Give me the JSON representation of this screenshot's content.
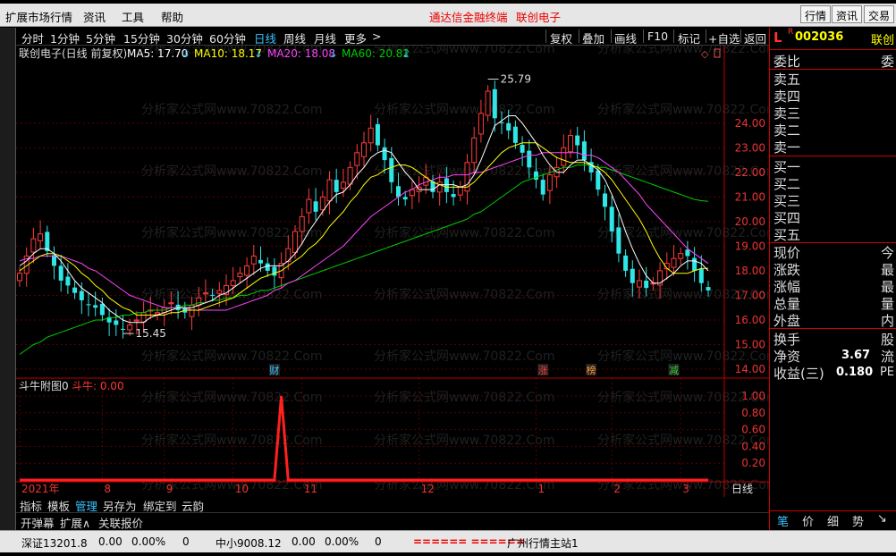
{
  "menu": {
    "items": [
      "扩展市场行情",
      "资讯",
      "工具",
      "帮助"
    ],
    "brand": "通达信金融终端",
    "stock_title": "联创电子",
    "right_buttons": [
      "行情",
      "资讯",
      "交易"
    ]
  },
  "toolbar": {
    "timeframes": [
      "分时",
      "1分钟",
      "5分钟",
      "15分钟",
      "30分钟",
      "60分钟",
      "日线",
      "周线",
      "月线",
      "更多"
    ],
    "active": "日线",
    "more_arrow": ">",
    "actions": [
      "复权",
      "叠加",
      "画线",
      "F10",
      "标记",
      "+自选",
      "返回"
    ]
  },
  "header": {
    "name": "联创电子(日线 前复权)",
    "ma5": "MA5: 17.70",
    "ma10": "MA10: 18.17",
    "ma20": "MA20: 18.08",
    "ma60": "MA60: 20.82",
    "down": "↓"
  },
  "quote": {
    "marker": "L",
    "r": "R",
    "code": "002036",
    "name": "联创",
    "wb": "委比",
    "wc": "委",
    "sell": [
      "卖五",
      "卖四",
      "卖三",
      "卖二",
      "卖一"
    ],
    "buy": [
      "买一",
      "买二",
      "买三",
      "买四",
      "买五"
    ],
    "fields": [
      "现价",
      "涨跌",
      "涨幅",
      "总量",
      "外盘"
    ],
    "fields_r": [
      "今",
      "最",
      "最",
      "量",
      "内"
    ],
    "turnover": "换手",
    "turnover_r": "股",
    "nav": "净资",
    "nav_v": "3.67",
    "nav_r": "流",
    "eps": "收益(三)",
    "eps_v": "0.180",
    "eps_r": "PE",
    "bottom_tabs": [
      "笔",
      "价",
      "细",
      "势"
    ]
  },
  "chart_data": {
    "type": "candlestick",
    "title": "联创电子(日线 前复权)",
    "ylim": [
      14.0,
      26.5
    ],
    "y_ticks": [
      "24.00",
      "23.00",
      "22.00",
      "21.00",
      "20.00",
      "19.00",
      "18.00",
      "17.00",
      "16.00",
      "15.00",
      "14.00"
    ],
    "x_ticks": [
      "2021年",
      "8",
      "9",
      "10",
      "11",
      "12",
      "1",
      "2",
      "3"
    ],
    "annotations": {
      "high": "25.79",
      "low": "15.45"
    },
    "events": [
      "财",
      "涨",
      "榜",
      "减"
    ],
    "ma_colors": {
      "ma5": "#ffffff",
      "ma10": "#ffff00",
      "ma20": "#ff44ff",
      "ma60": "#00cc00"
    },
    "close": [
      17.9,
      18.6,
      19.3,
      19.5,
      18.8,
      18.2,
      17.6,
      17.4,
      17.1,
      16.8,
      16.6,
      16.5,
      16.2,
      15.9,
      15.8,
      15.6,
      15.8,
      16.0,
      16.3,
      16.4,
      16.3,
      16.5,
      16.7,
      16.4,
      16.3,
      16.6,
      16.9,
      17.1,
      17.0,
      17.2,
      17.4,
      17.6,
      17.9,
      18.2,
      18.6,
      18.3,
      18.0,
      17.8,
      18.3,
      18.9,
      19.6,
      20.2,
      20.9,
      20.4,
      21.0,
      21.7,
      21.2,
      21.6,
      22.2,
      22.8,
      23.2,
      23.8,
      23.1,
      22.5,
      21.6,
      21.0,
      20.9,
      21.3,
      21.4,
      21.8,
      21.2,
      21.6,
      21.2,
      21.0,
      21.4,
      22.4,
      23.4,
      24.4,
      25.3,
      24.2,
      24.0,
      23.7,
      23.2,
      22.8,
      22.2,
      21.7,
      21.1,
      21.9,
      22.2,
      23.0,
      23.5,
      23.1,
      22.5,
      22.0,
      21.3,
      20.6,
      19.6,
      18.7,
      18.0,
      17.5,
      17.6,
      17.3,
      17.5,
      18.0,
      18.3,
      18.5,
      18.7,
      18.6,
      18.0,
      17.5,
      17.2
    ],
    "ma5": [
      18.2,
      18.4,
      18.7,
      18.9,
      18.9,
      18.7,
      18.4,
      18.0,
      17.6,
      17.3,
      17.1,
      16.9,
      16.7,
      16.4,
      16.2,
      16.0,
      15.9,
      15.9,
      15.9,
      16.1,
      16.2,
      16.3,
      16.4,
      16.5,
      16.5,
      16.5,
      16.6,
      16.7,
      16.8,
      17.0,
      17.1,
      17.3,
      17.5,
      17.7,
      17.9,
      18.1,
      18.2,
      18.2,
      18.2,
      18.4,
      18.7,
      19.1,
      19.6,
      20.0,
      20.4,
      20.8,
      21.1,
      21.2,
      21.5,
      21.9,
      22.2,
      22.6,
      22.8,
      22.9,
      22.8,
      22.4,
      22.0,
      21.7,
      21.3,
      21.3,
      21.3,
      21.5,
      21.5,
      21.5,
      21.4,
      21.5,
      21.9,
      22.5,
      23.2,
      23.9,
      24.1,
      24.3,
      24.3,
      24.0,
      23.6,
      23.2,
      22.7,
      22.3,
      22.0,
      22.0,
      22.3,
      22.5,
      22.5,
      22.3,
      22.1,
      21.7,
      21.1,
      20.4,
      19.6,
      18.9,
      18.3,
      17.8,
      17.5,
      17.5,
      17.7,
      17.9,
      18.2,
      18.4,
      18.4,
      18.3,
      18.0
    ],
    "ma10": [
      18.0,
      18.2,
      18.4,
      18.6,
      18.7,
      18.7,
      18.6,
      18.4,
      18.2,
      17.9,
      17.7,
      17.4,
      17.2,
      16.9,
      16.7,
      16.5,
      16.4,
      16.2,
      16.2,
      16.2,
      16.2,
      16.2,
      16.3,
      16.3,
      16.4,
      16.4,
      16.4,
      16.5,
      16.6,
      16.7,
      16.8,
      16.9,
      17.1,
      17.3,
      17.5,
      17.7,
      17.8,
      17.9,
      18.0,
      18.2,
      18.4,
      18.6,
      18.9,
      19.1,
      19.4,
      19.8,
      20.1,
      20.4,
      20.8,
      21.1,
      21.5,
      21.8,
      21.9,
      22.1,
      22.2,
      22.3,
      22.3,
      22.2,
      22.0,
      21.8,
      21.6,
      21.5,
      21.4,
      21.4,
      21.4,
      21.4,
      21.6,
      21.9,
      22.2,
      22.5,
      22.8,
      23.0,
      23.1,
      23.2,
      23.2,
      23.2,
      23.0,
      22.8,
      22.6,
      22.5,
      22.4,
      22.4,
      22.4,
      22.3,
      22.2,
      22.0,
      21.7,
      21.3,
      20.9,
      20.5,
      20.1,
      19.6,
      19.0,
      18.5,
      18.1,
      17.9,
      17.9,
      17.9,
      18.0,
      18.1,
      18.1
    ],
    "ma20": [
      18.4,
      18.5,
      18.5,
      18.6,
      18.6,
      18.6,
      18.6,
      18.5,
      18.4,
      18.3,
      18.1,
      18.0,
      17.8,
      17.6,
      17.4,
      17.2,
      17.0,
      16.9,
      16.8,
      16.7,
      16.6,
      16.5,
      16.5,
      16.5,
      16.5,
      16.4,
      16.4,
      16.4,
      16.4,
      16.4,
      16.4,
      16.5,
      16.6,
      16.7,
      16.8,
      16.9,
      17.0,
      17.2,
      17.3,
      17.5,
      17.6,
      17.8,
      18.0,
      18.2,
      18.4,
      18.6,
      18.8,
      19.0,
      19.3,
      19.6,
      19.9,
      20.2,
      20.4,
      20.6,
      20.8,
      21.0,
      21.2,
      21.3,
      21.5,
      21.6,
      21.7,
      21.8,
      21.8,
      21.9,
      21.9,
      21.9,
      22.0,
      22.0,
      22.1,
      22.2,
      22.3,
      22.4,
      22.5,
      22.6,
      22.7,
      22.7,
      22.8,
      22.8,
      22.8,
      22.8,
      22.8,
      22.8,
      22.7,
      22.7,
      22.6,
      22.4,
      22.2,
      22.0,
      21.7,
      21.4,
      21.1,
      20.7,
      20.4,
      20.1,
      19.8,
      19.5,
      19.2,
      18.9,
      18.7,
      18.5,
      18.3
    ],
    "ma60": [
      14.6,
      14.8,
      15.0,
      15.1,
      15.3,
      15.4,
      15.5,
      15.6,
      15.7,
      15.8,
      15.9,
      16.0,
      16.0,
      16.1,
      16.1,
      16.2,
      16.2,
      16.3,
      16.3,
      16.4,
      16.4,
      16.4,
      16.5,
      16.5,
      16.6,
      16.6,
      16.7,
      16.7,
      16.8,
      16.8,
      16.9,
      16.9,
      17.0,
      17.0,
      17.1,
      17.2,
      17.2,
      17.3,
      17.4,
      17.5,
      17.6,
      17.7,
      17.8,
      17.9,
      18.0,
      18.1,
      18.2,
      18.3,
      18.4,
      18.5,
      18.6,
      18.7,
      18.8,
      18.9,
      19.0,
      19.1,
      19.2,
      19.3,
      19.4,
      19.5,
      19.6,
      19.7,
      19.8,
      19.9,
      20.0,
      20.1,
      20.3,
      20.4,
      20.6,
      20.8,
      21.0,
      21.2,
      21.4,
      21.6,
      21.7,
      21.8,
      21.9,
      22.0,
      22.1,
      22.2,
      22.2,
      22.3,
      22.3,
      22.3,
      22.2,
      22.2,
      22.1,
      22.0,
      21.9,
      21.8,
      21.7,
      21.6,
      21.5,
      21.4,
      21.3,
      21.2,
      21.1,
      21.0,
      20.9,
      20.85,
      20.82
    ]
  },
  "sub_chart": {
    "title": "斗牛附图0",
    "label": "斗牛: 0.00",
    "y_ticks": [
      "1.00",
      "0.80",
      "0.60",
      "0.40",
      "0.20",
      "0.00"
    ],
    "spike_index": 38,
    "spike_value": 1.0
  },
  "bottom_tabs": [
    "指标",
    "模板",
    "管理",
    "另存为",
    "绑定到",
    "云韵"
  ],
  "bottom_tabs2": [
    "开弹幕",
    "扩展∧",
    "关联报价"
  ],
  "period_label": "日线",
  "zoom_controls": [
    "+",
    "-",
    "0"
  ],
  "status": {
    "sz": "深证13201.8",
    "sz_chg": "0.00",
    "sz_pct": "0.00%",
    "sz_vol": "0",
    "zx": "中小9008.12",
    "zx_chg": "0.00",
    "zx_pct": "0.00%",
    "zx_vol": "0",
    "bar": "====== ======",
    "server": "广州行情主站1"
  },
  "watermark": "分析家公式网www.70822.Com"
}
